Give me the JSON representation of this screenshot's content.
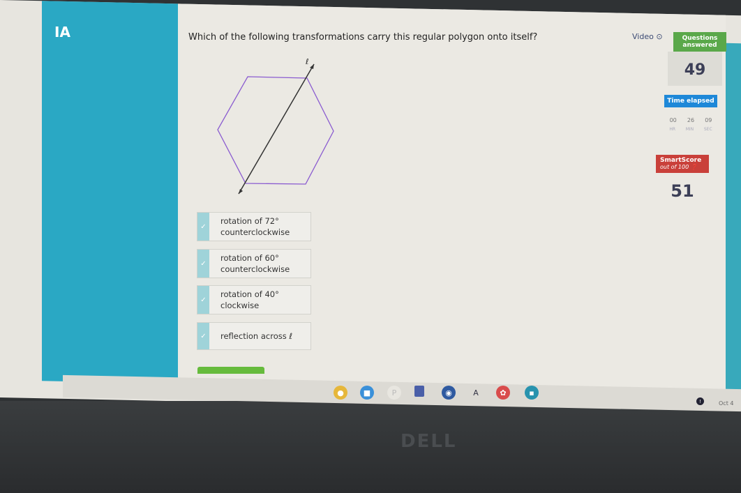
{
  "question": "Which of the following transformations carry this regular polygon onto itself?",
  "figure": {
    "line_label": "ℓ"
  },
  "choices": [
    {
      "line1": "rotation of 72°",
      "line2": "counterclockwise",
      "checked": true
    },
    {
      "line1": "rotation of 60°",
      "line2": "counterclockwise",
      "checked": true
    },
    {
      "line1": "rotation of 40°",
      "line2": "clockwise",
      "checked": true
    },
    {
      "line1": "reflection across ℓ",
      "line2": "",
      "checked": true
    }
  ],
  "sidebar": {
    "video_label": "Video",
    "questions_answered_label": "Questions answered",
    "questions_answered": "49",
    "time_elapsed_label": "Time elapsed",
    "time": {
      "hr": "00",
      "min": "26",
      "sec": "09",
      "hr_label": "HR",
      "min_label": "MIN",
      "sec_label": "SEC"
    },
    "smartscore_label": "SmartScore",
    "smartscore_sub": "out of 100",
    "smartscore": "51"
  },
  "taskbar": {
    "date": "Oct 4",
    "apps": [
      "chrome",
      "zoom",
      "files",
      "slides",
      "eye-app",
      "text-app",
      "paint-app",
      "classroom-app"
    ]
  },
  "bezel_brand": "DELL",
  "colors": {
    "green": "#5aa84a",
    "blue": "#1e88d8",
    "red": "#c9403a",
    "teal": "#2aa8c4"
  }
}
